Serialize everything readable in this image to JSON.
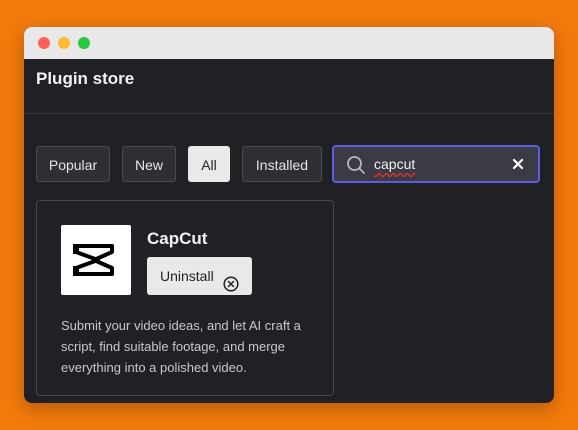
{
  "window": {
    "title": "Plugin store"
  },
  "filters": [
    {
      "label": "Popular",
      "active": false
    },
    {
      "label": "New",
      "active": false
    },
    {
      "label": "All",
      "active": true
    },
    {
      "label": "Installed",
      "active": false
    }
  ],
  "search": {
    "value": "capcut",
    "icon": "search-icon",
    "clear_icon": "close-icon"
  },
  "plugin": {
    "name": "CapCut",
    "button_label": "Uninstall",
    "button_icon": "circle-x-icon",
    "description": "Submit your video ideas, and let AI craft a script, find suitable footage, and merge everything into a polished video."
  },
  "colors": {
    "background": "#f27a0c",
    "window_bg": "#202124",
    "accent": "#5c5ce0"
  }
}
